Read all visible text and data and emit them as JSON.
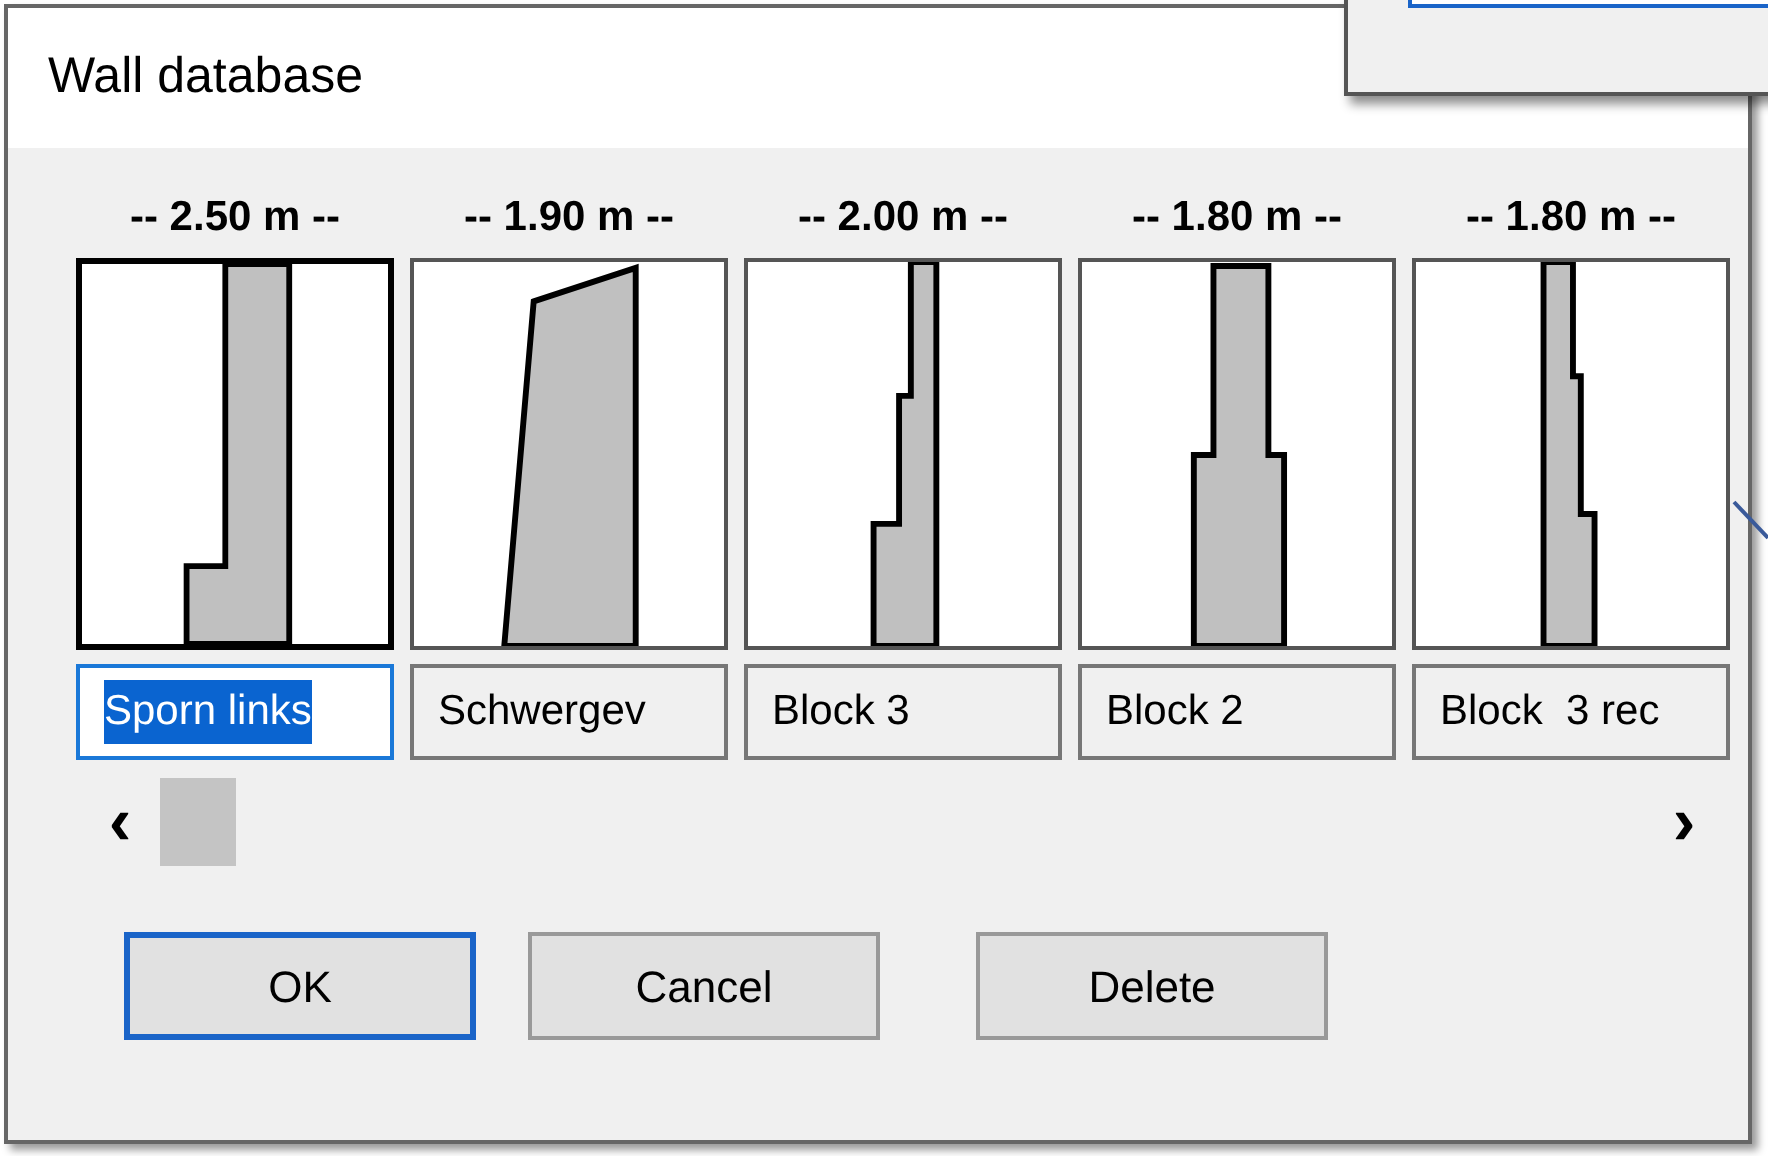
{
  "window": {
    "title": "Wall database"
  },
  "walls": [
    {
      "width": "-- 2.50 m --",
      "name": "Sporn links",
      "kind": "spur",
      "selected": true
    },
    {
      "width": "-- 1.90 m --",
      "name": "Schwergev",
      "kind": "gravity",
      "selected": false
    },
    {
      "width": "-- 2.00 m --",
      "name": "Block 3",
      "kind": "block3",
      "selected": false
    },
    {
      "width": "-- 1.80 m --",
      "name": "Block 2",
      "kind": "block2",
      "selected": false
    },
    {
      "width": "-- 1.80 m --",
      "name": "Block  3 rec",
      "kind": "block3rec",
      "selected": false
    }
  ],
  "scroll": {
    "left": "‹",
    "right": "›"
  },
  "buttons": [
    {
      "label": "OK",
      "default": true
    },
    {
      "label": "Cancel",
      "default": false
    },
    {
      "label": "Delete",
      "default": false
    }
  ]
}
